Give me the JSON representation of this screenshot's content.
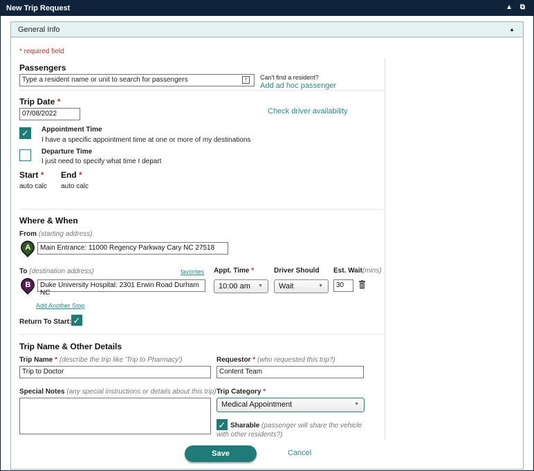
{
  "window": {
    "title": "New Trip Request",
    "controls": "▲ ⧉"
  },
  "section": {
    "title": "General Info"
  },
  "required_note": "* required field",
  "passengers": {
    "heading": "Passengers",
    "placeholder": "Type a resident name or unit to search for passengers",
    "cant_find": "Can't find a resident?",
    "add_adhoc": "Add ad hoc passenger"
  },
  "trip_date": {
    "label": "Trip Date",
    "value": "07/08/2022",
    "check_availability": "Check driver availability"
  },
  "time_mode": {
    "appointment_title": "Appointment Time",
    "appointment_desc": "I have a specific appointment time at one or more of my destinations",
    "appointment_checked": true,
    "departure_title": "Departure Time",
    "departure_desc": "I just need to specify what time I depart",
    "departure_checked": false
  },
  "start_end": {
    "start_label": "Start",
    "start_value": "auto calc",
    "end_label": "End",
    "end_value": "auto calc"
  },
  "where_when": {
    "heading": "Where & When",
    "from_label": "From",
    "from_hint": "(starting address)",
    "from_pin": "A",
    "from_value": "Main Entrance: 11000 Regency Parkway Cary NC 27518",
    "to_label": "To",
    "to_hint": "(destination address)",
    "favorites": "favorites",
    "to_pin": "B",
    "to_value": "Duke University Hospital: 2301 Erwin Road Durham NC",
    "appt_time_label": "Appt. Time",
    "appt_time_value": "10:00 am",
    "driver_should_label": "Driver Should",
    "driver_should_value": "Wait",
    "est_wait_label": "Est. Wait",
    "est_wait_unit": "(mins)",
    "est_wait_value": "30",
    "add_stop": "Add Another Stop",
    "return_label": "Return To Start:",
    "return_checked": true
  },
  "details": {
    "heading": "Trip Name & Other Details",
    "trip_name_label": "Trip Name",
    "trip_name_hint": "(describe the trip like 'Trip to Pharmacy')",
    "trip_name_value": "Trip to Doctor",
    "requestor_label": "Requestor",
    "requestor_hint": "(who requested this trip?)",
    "requestor_value": "Content Team",
    "notes_label": "Special Notes",
    "notes_hint": "(any special instructions or details about this trip)",
    "notes_value": "",
    "category_label": "Trip Category",
    "category_value": "Medical Appointment",
    "sharable_label": "Sharable",
    "sharable_hint": "(passenger will share the vehicle with other residents?)",
    "sharable_checked": true
  },
  "actions": {
    "save": "Save",
    "cancel": "Cancel"
  },
  "colors": {
    "accent": "#1f7b78",
    "titlebar": "#0f243b",
    "required": "#c0392b",
    "link": "#2a8a86"
  }
}
